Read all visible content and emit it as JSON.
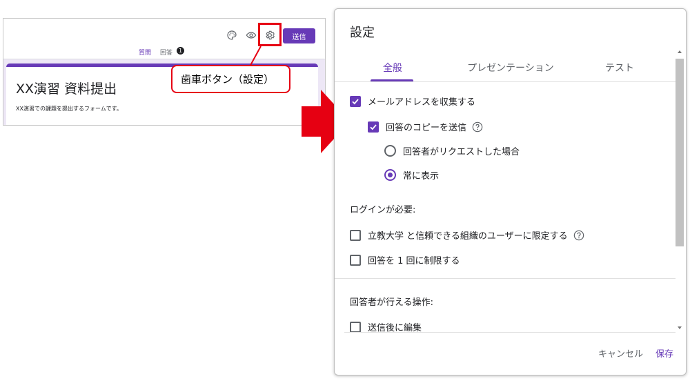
{
  "editor": {
    "send_label": "送信",
    "tabs": {
      "questions": "質問",
      "responses": "回答",
      "responses_badge": "1"
    },
    "form_title": "XX演習 資料提出",
    "form_description": "XX演習での課題を提出するフォームです。",
    "icons": [
      "palette-icon",
      "preview-eye-icon",
      "gear-icon"
    ]
  },
  "annotation": {
    "callout_text": "歯車ボタン（設定）",
    "highlight_color": "#e60012"
  },
  "dialog": {
    "title": "設定",
    "tabs": [
      "全般",
      "プレゼンテーション",
      "テスト"
    ],
    "active_tab": "全般",
    "options": {
      "collect_email": {
        "label": "メールアドレスを収集する",
        "checked": true
      },
      "send_copy": {
        "label": "回答のコピーを送信",
        "checked": true
      },
      "copy_on_request": {
        "label": "回答者がリクエストした場合",
        "selected": false
      },
      "copy_always": {
        "label": "常に表示",
        "selected": true
      }
    },
    "login_section": {
      "heading": "ログインが必要:",
      "restrict_org": {
        "label": "立教大学 と信頼できる組織のユーザーに限定する",
        "checked": false
      },
      "limit_one": {
        "label": "回答を 1 回に制限する",
        "checked": false
      }
    },
    "respondent_section": {
      "heading": "回答者が行える操作:",
      "edit_after": {
        "label": "送信後に編集",
        "checked": false
      }
    },
    "buttons": {
      "cancel": "キャンセル",
      "save": "保存"
    }
  },
  "colors": {
    "accent": "#673ab7",
    "annotation_red": "#e60012"
  }
}
